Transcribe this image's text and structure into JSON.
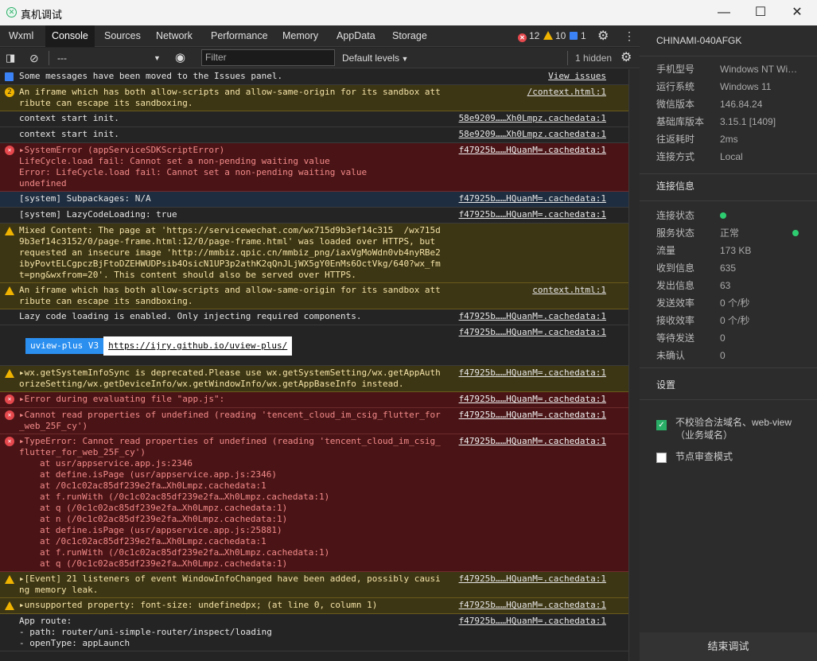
{
  "window": {
    "title": "真机调试",
    "minimize": "—",
    "maximize": "☐",
    "close": "✕"
  },
  "tabs": [
    "Wxml",
    "Console",
    "Sources",
    "Network",
    "Performance",
    "Memory",
    "AppData",
    "Storage"
  ],
  "badges": {
    "errors": "12",
    "warnings": "10",
    "info": "1"
  },
  "toolbar": {
    "context": "---",
    "filter_placeholder": "Filter",
    "levels": "Default levels",
    "hidden": "1 hidden"
  },
  "console": [
    {
      "type": "info",
      "icon": "b",
      "text": "Some messages have been moved to the Issues panel.",
      "src": "View issues"
    },
    {
      "type": "warn",
      "icon": "n",
      "text": "An iframe which has both allow-scripts and allow-same-origin for its sandbox attribute can escape its sandboxing.",
      "src": "/context.html:1"
    },
    {
      "type": "plain",
      "text": "context start init.",
      "src": "58e9209……Xh0Lmpz.cachedata:1"
    },
    {
      "type": "plain",
      "text": "context start init.",
      "src": "58e9209……Xh0Lmpz.cachedata:1"
    },
    {
      "type": "err",
      "icon": "e",
      "text": "▸SystemError (appServiceSDKScriptError)\nLifeCycle.load fail: Cannot set a non-pending waiting value\nError: LifeCycle.load fail: Cannot set a non-pending waiting value\nundefined",
      "src": "f47925b……HQuanM=.cachedata:1"
    },
    {
      "type": "sel",
      "text": "[system] Subpackages: N/A",
      "src": "f47925b……HQuanM=.cachedata:1"
    },
    {
      "type": "plain",
      "text": "[system] LazyCodeLoading: true",
      "src": "f47925b……HQuanM=.cachedata:1"
    },
    {
      "type": "warn",
      "icon": "w",
      "text": "Mixed Content: The page at 'https://servicewechat.com/wx715d9b3ef14c315  /wx715d9b3ef14c3152/0/page-frame.html:12/0/page-frame.html' was loaded over HTTPS, but requested an insecure image 'http://mmbiz.qpic.cn/mmbiz_png/iaxVgMoWdn0vb4nyRBe2ibyPovtELCgpczBjFtoDZEHWUDPsib4OsicN1UP3p2athK2qQnJLjWX5gY0EnMs6OctVkg/640?wx_fmt=png&wxfrom=20'. This content should also be served over HTTPS.",
      "src": ""
    },
    {
      "type": "warn",
      "icon": "w",
      "text": "An iframe which has both allow-scripts and allow-same-origin for its sandbox attribute can escape its sandboxing.",
      "src": "context.html:1"
    },
    {
      "type": "plain",
      "text": "Lazy code loading is enabled. Only injecting required components.",
      "src": "f47925b……HQuanM=.cachedata:1"
    },
    {
      "type": "uview",
      "label": "uview-plus V3",
      "link": "https://ijry.github.io/uview-plus/",
      "src": "f47925b……HQuanM=.cachedata:1"
    },
    {
      "type": "warn",
      "icon": "w",
      "text": "▸wx.getSystemInfoSync is deprecated.Please use wx.getSystemSetting/wx.getAppAuthorizeSetting/wx.getDeviceInfo/wx.getWindowInfo/wx.getAppBaseInfo instead.",
      "src": "f47925b……HQuanM=.cachedata:1"
    },
    {
      "type": "err",
      "icon": "e",
      "text": "▸Error during evaluating file \"app.js\":",
      "src": "f47925b……HQuanM=.cachedata:1"
    },
    {
      "type": "err",
      "icon": "e",
      "text": "▸Cannot read properties of undefined (reading 'tencent_cloud_im_csig_flutter_for_web_25F_cy')",
      "src": "f47925b……HQuanM=.cachedata:1"
    },
    {
      "type": "err",
      "icon": "e",
      "text": "▸TypeError: Cannot read properties of undefined (reading 'tencent_cloud_im_csig_flutter_for_web_25F_cy')",
      "src": "f47925b……HQuanM=.cachedata:1",
      "stack": [
        "at usr/appservice.app.js:2346",
        "at define.isPage (usr/appservice.app.js:2346)",
        "at /0c1c02ac85df239e2fa…Xh0Lmpz.cachedata:1",
        "at f.runWith (/0c1c02ac85df239e2fa…Xh0Lmpz.cachedata:1)",
        "at q (/0c1c02ac85df239e2fa…Xh0Lmpz.cachedata:1)",
        "at n (/0c1c02ac85df239e2fa…Xh0Lmpz.cachedata:1)",
        "at define.isPage (usr/appservice.app.js:25881)",
        "at /0c1c02ac85df239e2fa…Xh0Lmpz.cachedata:1",
        "at f.runWith (/0c1c02ac85df239e2fa…Xh0Lmpz.cachedata:1)",
        "at q (/0c1c02ac85df239e2fa…Xh0Lmpz.cachedata:1)"
      ]
    },
    {
      "type": "warn",
      "icon": "w",
      "text": "▸[Event] 21 listeners of event WindowInfoChanged have been added, possibly causing memory leak.",
      "src": "f47925b……HQuanM=.cachedata:1"
    },
    {
      "type": "warn",
      "icon": "w",
      "text": "▸unsupported property: font-size: undefinedpx; (at line 0, column 1)",
      "src": "f47925b……HQuanM=.cachedata:1"
    },
    {
      "type": "plain",
      "text": "App route:\n- path: router/uni-simple-router/inspect/loading\n- openType: appLaunch",
      "src": "f47925b……HQuanM=.cachedata:1"
    }
  ],
  "side": {
    "device": "CHINAMI-040AFGK",
    "info": [
      {
        "k": "手机型号",
        "v": "Windows NT Wi…"
      },
      {
        "k": "运行系统",
        "v": "Windows 11"
      },
      {
        "k": "微信版本",
        "v": "146.84.24"
      },
      {
        "k": "基础库版本",
        "v": "3.15.1 [1409]"
      },
      {
        "k": "往返耗时",
        "v": "2ms"
      },
      {
        "k": "连接方式",
        "v": "Local"
      }
    ],
    "conn_title": "连接信息",
    "conn": [
      {
        "k": "连接状态",
        "v": ""
      },
      {
        "k": "服务状态",
        "v": "正常"
      },
      {
        "k": "流量",
        "v": "173 KB"
      },
      {
        "k": "收到信息",
        "v": "635"
      },
      {
        "k": "发出信息",
        "v": "63"
      },
      {
        "k": "发送效率",
        "v": "0 个/秒"
      },
      {
        "k": "接收效率",
        "v": "0 个/秒"
      },
      {
        "k": "等待发送",
        "v": "0"
      },
      {
        "k": "未确认",
        "v": "0"
      }
    ],
    "settings_title": "设置",
    "opt1": "不校验合法域名、web-view（业务域名）",
    "opt2": "节点审查模式",
    "end": "结束调试"
  }
}
